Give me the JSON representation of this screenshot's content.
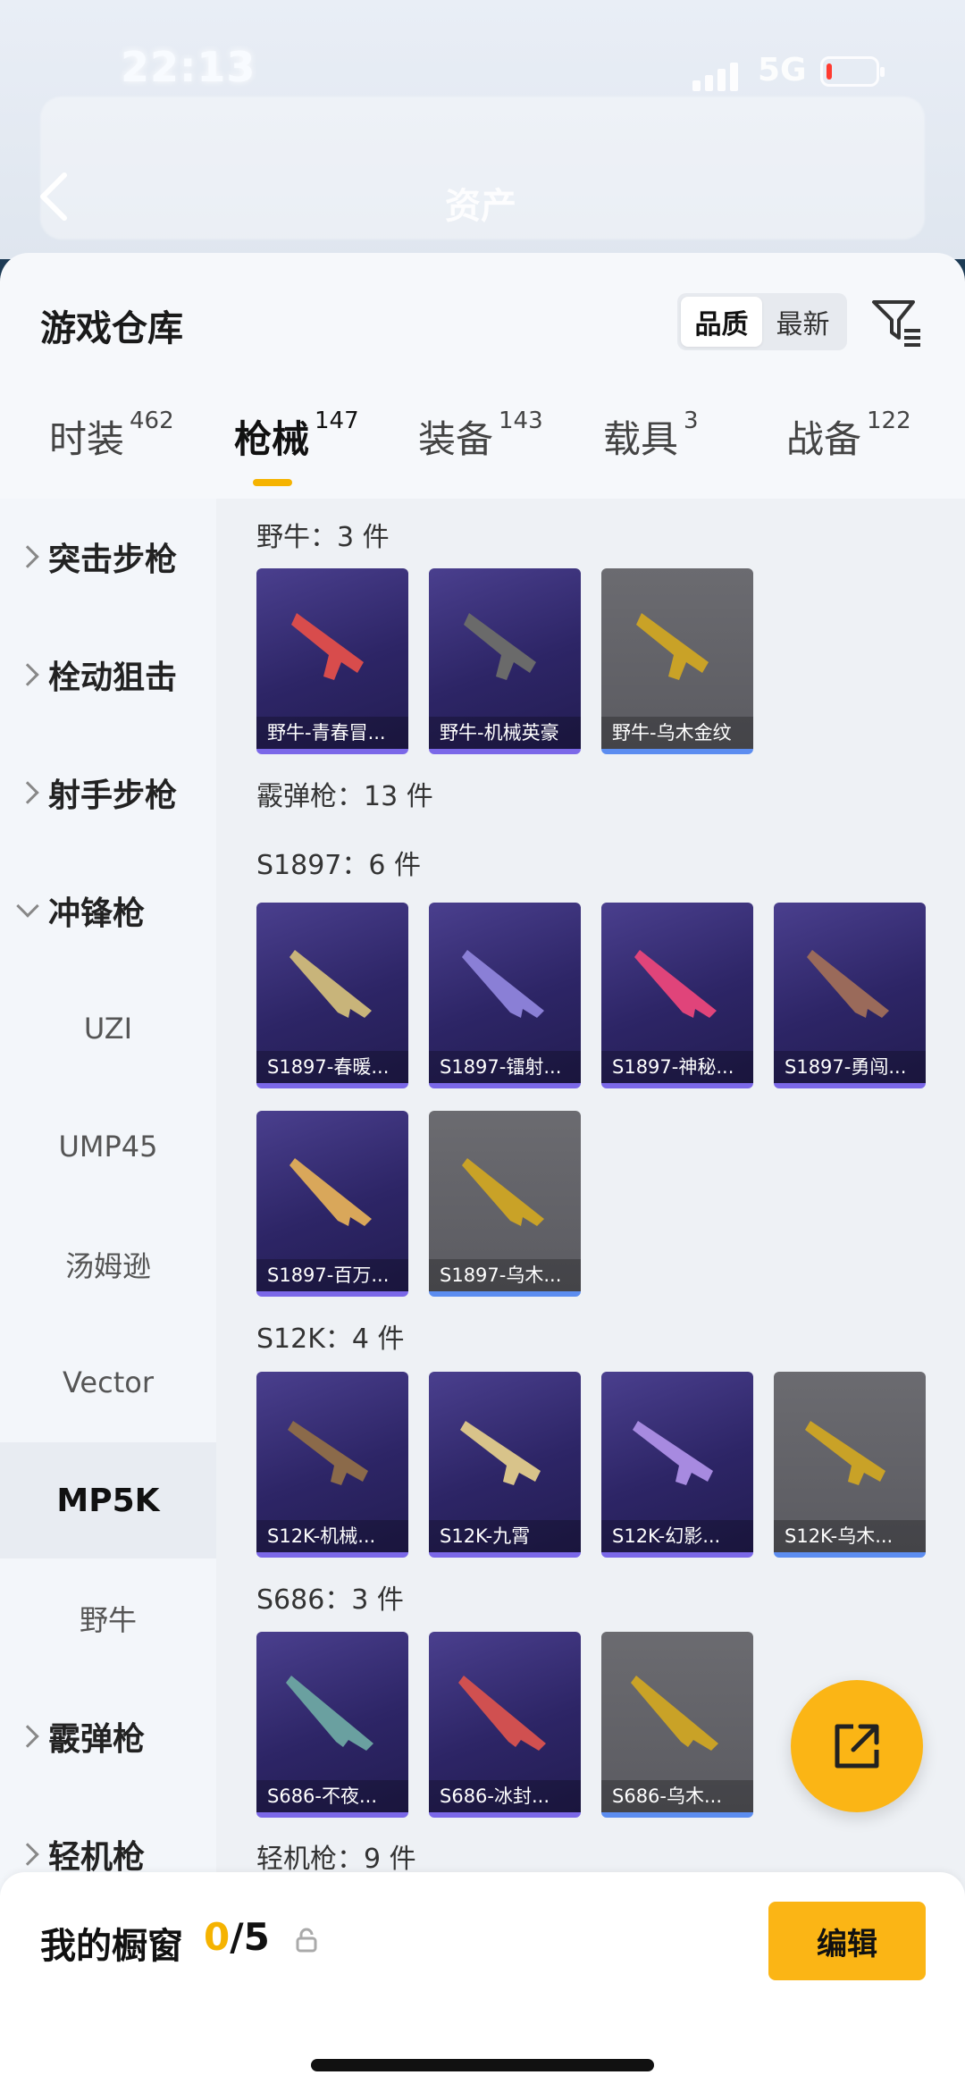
{
  "status_bar": {
    "time": "22:13",
    "network": "5G"
  },
  "header": {
    "title": "资产"
  },
  "panel": {
    "title": "游戏仓库",
    "sort": {
      "options": [
        "品质",
        "最新"
      ],
      "selected": "品质"
    }
  },
  "tabs": [
    {
      "label": "时装",
      "count": "462"
    },
    {
      "label": "枪械",
      "count": "147",
      "active": true
    },
    {
      "label": "装备",
      "count": "143"
    },
    {
      "label": "载具",
      "count": "3"
    },
    {
      "label": "战备",
      "count": "122"
    }
  ],
  "sidebar": {
    "items": [
      {
        "label": "突击步枪"
      },
      {
        "label": "栓动狙击"
      },
      {
        "label": "射手步枪"
      },
      {
        "label": "冲锋枪"
      },
      {
        "label": "霰弹枪"
      },
      {
        "label": "轻机枪"
      }
    ],
    "sub_items": [
      {
        "label": "UZI"
      },
      {
        "label": "UMP45"
      },
      {
        "label": "汤姆逊"
      },
      {
        "label": "Vector"
      },
      {
        "label": "MP5K"
      },
      {
        "label": "野牛"
      }
    ]
  },
  "content": {
    "sections": [
      {
        "title": "野牛：3 件",
        "items": [
          "野牛-青春冒...",
          "野牛-机械英豪",
          "野牛-乌木金纹"
        ]
      },
      {
        "title": "霰弹枪：13 件"
      },
      {
        "title": "S1897：6 件",
        "items": [
          "S1897-春暖...",
          "S1897-镭射...",
          "S1897-神秘...",
          "S1897-勇闯...",
          "S1897-百万...",
          "S1897-乌木..."
        ]
      },
      {
        "title": "S12K：4 件",
        "items": [
          "S12K-机械...",
          "S12K-九霄",
          "S12K-幻影...",
          "S12K-乌木..."
        ]
      },
      {
        "title": "S686：3 件",
        "items": [
          "S686-不夜...",
          "S686-冰封...",
          "S686-乌木..."
        ]
      },
      {
        "title": "轻机枪：9 件"
      }
    ]
  },
  "bottom_bar": {
    "label": "我的橱窗",
    "current": "0",
    "total": "/5",
    "edit_label": "编辑"
  },
  "colors": {
    "accent": "#fbb515",
    "purple_card": "#2d2566",
    "gray_card": "#5f5f65"
  }
}
